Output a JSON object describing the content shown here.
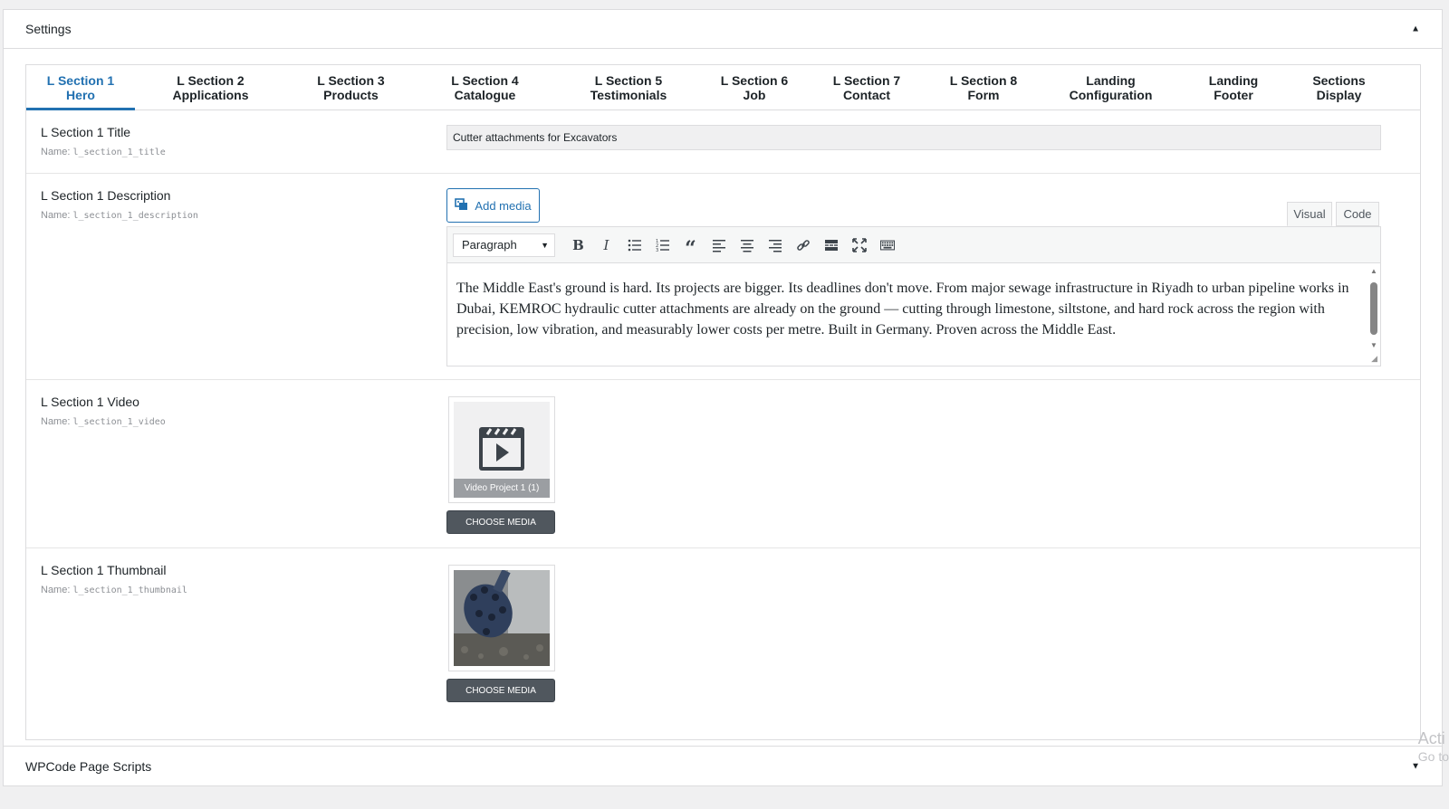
{
  "settings_panel": {
    "title": "Settings",
    "toggle": "▲"
  },
  "tabs": [
    {
      "line1": "L Section 1",
      "line2": "Hero"
    },
    {
      "line1": "L Section 2",
      "line2": "Applications"
    },
    {
      "line1": "L Section 3",
      "line2": "Products"
    },
    {
      "line1": "L Section 4",
      "line2": "Catalogue"
    },
    {
      "line1": "L Section 5",
      "line2": "Testimonials"
    },
    {
      "line1": "L Section 6",
      "line2": "Job"
    },
    {
      "line1": "L Section 7",
      "line2": "Contact"
    },
    {
      "line1": "L Section 8",
      "line2": "Form"
    },
    {
      "line1": "Landing",
      "line2": "Configuration"
    },
    {
      "line1": "Landing",
      "line2": "Footer"
    },
    {
      "line1": "Sections",
      "line2": "Display"
    }
  ],
  "fields": {
    "title": {
      "label": "L Section 1 Title",
      "name_prefix": "Name:",
      "name": "l_section_1_title",
      "value": "Cutter attachments for Excavators"
    },
    "description": {
      "label": "L Section 1 Description",
      "name_prefix": "Name:",
      "name": "l_section_1_description",
      "add_media": "Add media",
      "tab_visual": "Visual",
      "tab_code": "Code",
      "format": "Paragraph",
      "content": "The Middle East's ground is hard. Its projects are bigger. Its deadlines don't move. From major sewage infrastructure in Riyadh to urban pipeline works in Dubai, KEMROC hydraulic cutter attachments are already on the ground — cutting through limestone, siltstone, and hard rock across the region with precision, low vibration, and measurably lower costs per metre. Built in Germany. Proven across the Middle East."
    },
    "video": {
      "label": "L Section 1 Video",
      "name_prefix": "Name:",
      "name": "l_section_1_video",
      "caption": "Video Project 1 (1)",
      "button": "CHOOSE MEDIA"
    },
    "thumbnail": {
      "label": "L Section 1 Thumbnail",
      "name_prefix": "Name:",
      "name": "l_section_1_thumbnail",
      "button": "CHOOSE MEDIA"
    }
  },
  "wpcode_panel": {
    "title": "WPCode Page Scripts",
    "toggle": "▼"
  },
  "watermark": {
    "line1": "Acti",
    "line2": "Go to"
  },
  "colors": {
    "accent": "#2271b1",
    "button_dark": "#50575e"
  }
}
